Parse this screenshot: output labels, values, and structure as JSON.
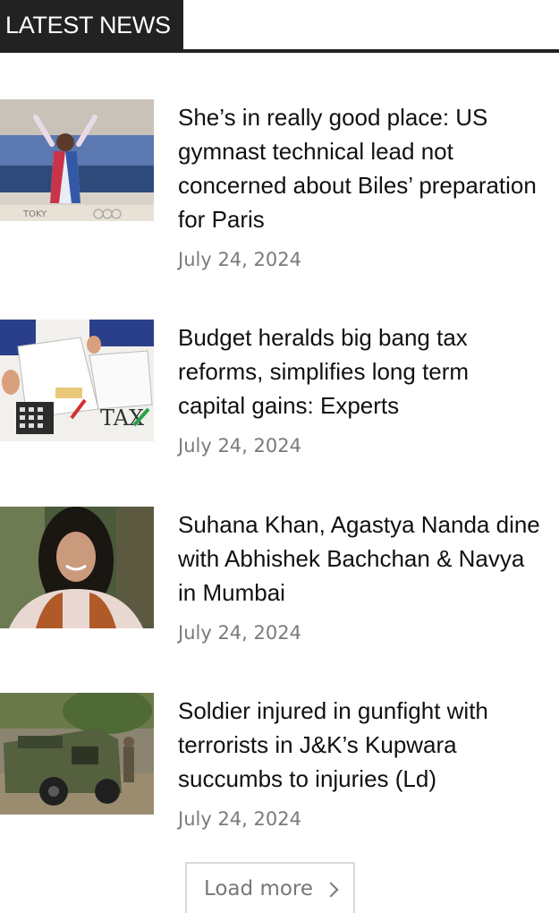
{
  "section": {
    "title": "LATEST NEWS"
  },
  "articles": [
    {
      "headline": "She’s in really good place: US gymnast technical lead not concerned about Biles’ preparation for Paris",
      "date": "July 24, 2024",
      "image_text": "TOKY"
    },
    {
      "headline": "Budget heralds big bang tax reforms, simplifies long term capital gains: Experts",
      "date": "July 24, 2024",
      "image_text": "TAX"
    },
    {
      "headline": "Suhana Khan, Agastya Nanda dine with Abhishek Bachchan & Navya in Mumbai",
      "date": "July 24, 2024"
    },
    {
      "headline": "Soldier injured in gunfight with terrorists in J&K’s Kupwara succumbs to injuries (Ld)",
      "date": "July 24, 2024"
    }
  ],
  "load_more": {
    "label": "Load more"
  }
}
